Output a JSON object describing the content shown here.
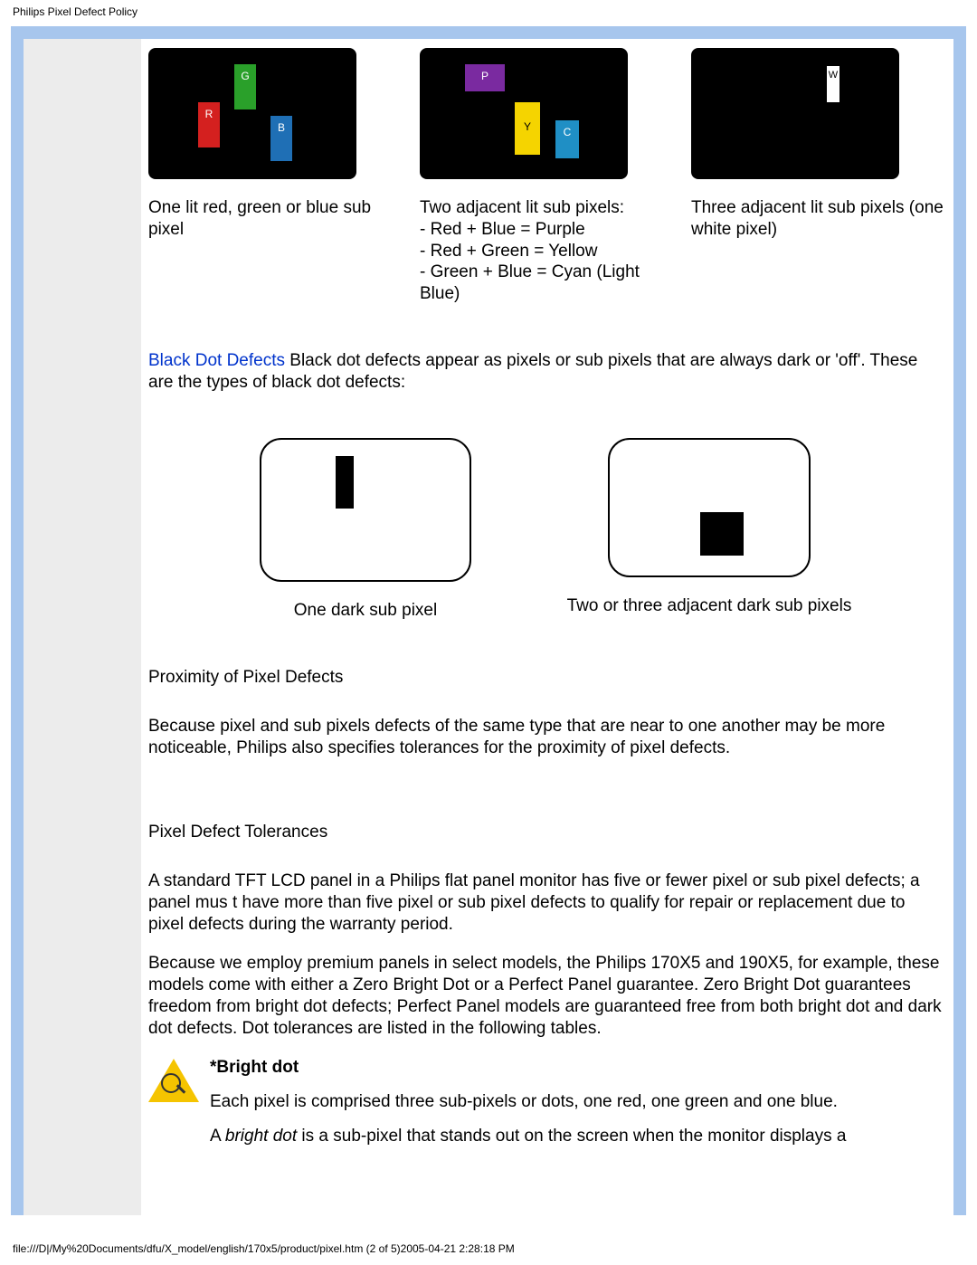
{
  "header": "Philips Pixel Defect Policy",
  "figrow1": {
    "col1_caption": "One lit red, green or blue sub pixel",
    "col2_caption_line1": "Two adjacent lit sub pixels:",
    "col2_caption_line2": "- Red + Blue = Purple",
    "col2_caption_line3": "- Red + Green = Yellow",
    "col2_caption_line4": "- Green + Blue = Cyan (Light Blue)",
    "col3_caption": "Three adjacent lit sub pixels (one white pixel)",
    "labels": {
      "R": "R",
      "G": "G",
      "B": "B",
      "P": "P",
      "Y": "Y",
      "C": "C",
      "W": "W"
    }
  },
  "blackdot": {
    "label": "Black Dot Defects",
    "text": " Black dot defects appear as pixels or sub pixels that are always dark or 'off'. These are the types of black dot defects:",
    "caption1": "One dark sub pixel",
    "caption2": "Two or three adjacent dark sub pixels"
  },
  "proximity": {
    "title": "Proximity of Pixel Defects",
    "para": "Because pixel and sub pixels defects of the same type that are near to one another may be more noticeable, Philips also specifies tolerances for the proximity of pixel defects."
  },
  "tolerances": {
    "title": "Pixel Defect Tolerances",
    "para1": "A standard TFT LCD panel in a Philips flat panel monitor has five or fewer pixel or sub pixel defects; a panel mus t have more than five pixel or sub pixel defects to qualify for repair or replacement due to pixel defects during the warranty period.",
    "para2": "Because we employ premium panels in select models, the Philips 170X5 and 190X5, for example, these models come with either a Zero Bright Dot or a Perfect Panel guarantee. Zero Bright Dot guarantees freedom from bright dot defects; Perfect Panel models are guaranteed free from both bright dot and dark dot defects. Dot tolerances are listed in the following tables."
  },
  "brightdot": {
    "heading": "*Bright dot",
    "line1": "Each pixel is comprised three sub-pixels or dots, one red, one green and one blue.",
    "line2a": "A ",
    "line2b": "bright dot",
    "line2c": " is a sub-pixel that stands out on the screen when the monitor displays a"
  },
  "footer": "file:///D|/My%20Documents/dfu/X_model/english/170x5/product/pixel.htm (2 of 5)2005-04-21 2:28:18 PM"
}
